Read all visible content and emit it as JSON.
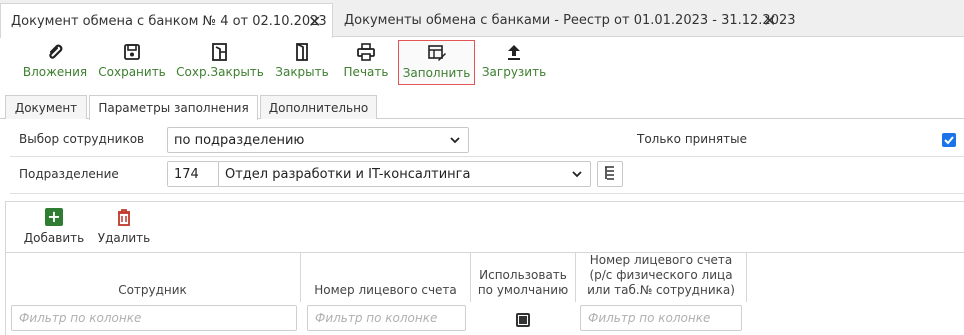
{
  "doc_tabs": [
    {
      "label": "Документ обмена с банком № 4 от 02.10.2023",
      "active": true
    },
    {
      "label": "Документы обмена с банками - Реестр от 01.01.2023 - 31.12.2023",
      "active": false
    }
  ],
  "toolbar": {
    "attachments": "Вложения",
    "save": "Сохранить",
    "save_close": "Сохр.Закрыть",
    "close": "Закрыть",
    "print": "Печать",
    "fill": "Заполнить",
    "upload": "Загрузить"
  },
  "form_tabs": [
    {
      "label": "Документ",
      "active": false
    },
    {
      "label": "Параметры заполнения",
      "active": true
    },
    {
      "label": "Дополнительно",
      "active": false
    }
  ],
  "form": {
    "employee_select_label": "Выбор сотрудников",
    "employee_select_value": "по подразделению",
    "only_accepted_label": "Только принятые",
    "only_accepted_checked": true,
    "department_label": "Подразделение",
    "department_code": "174",
    "department_name": "Отдел разработки и IT-консалтинга"
  },
  "grid": {
    "add_label": "Добавить",
    "delete_label": "Удалить",
    "columns": [
      "Сотрудник",
      "Номер лицевого счета",
      "Использовать по умолчанию",
      "Номер лицевого счета (р/с физического лица или таб.№ сотрудника)"
    ],
    "filter_placeholder": "Фильтр по колонке",
    "default_checked": true
  },
  "colors": {
    "accent_green": "#3d7f2f",
    "delete_red": "#c0392b",
    "checkbox_blue": "#1a73e8",
    "highlight": "#e05555"
  }
}
